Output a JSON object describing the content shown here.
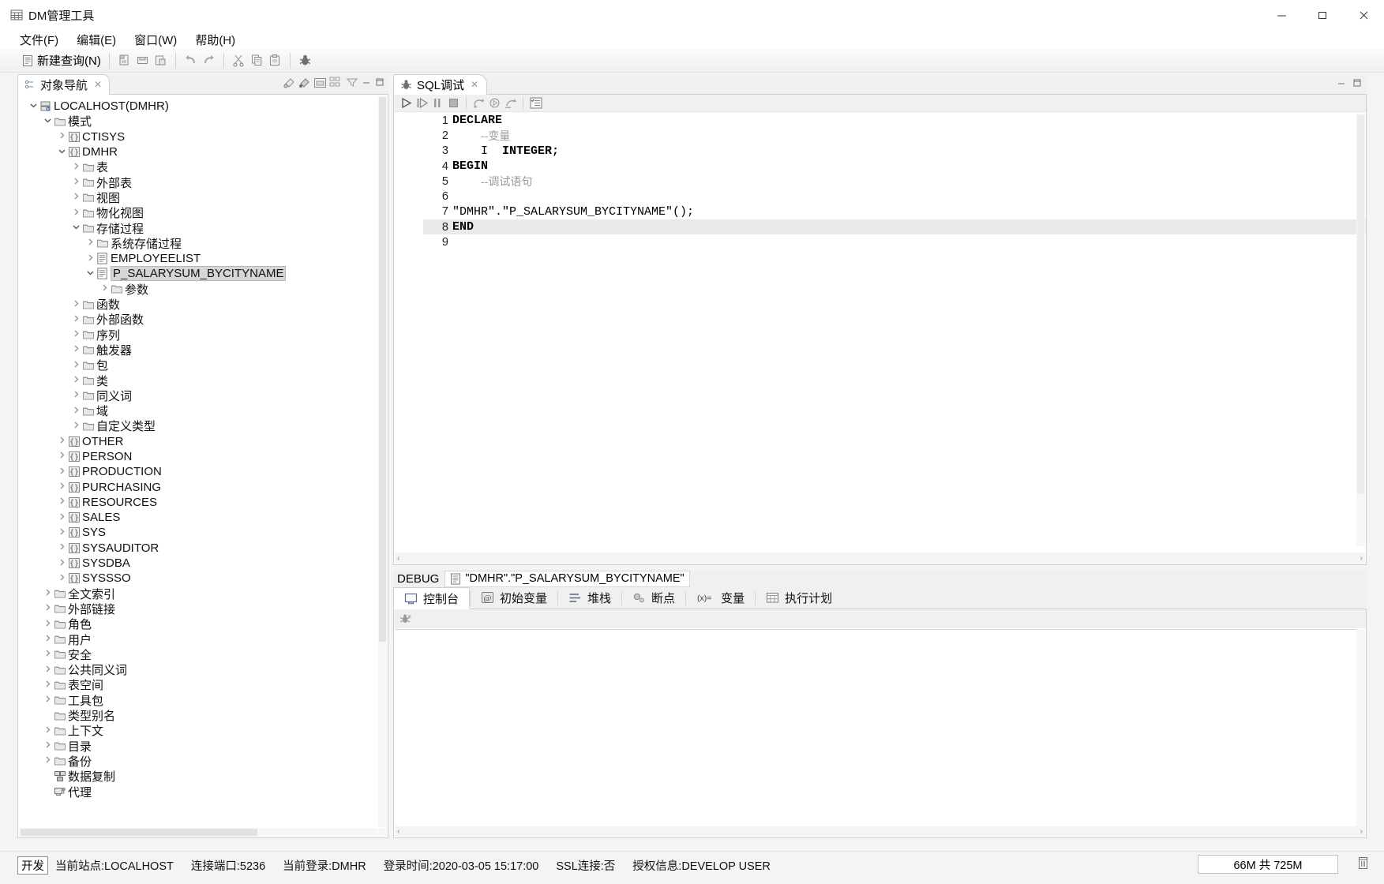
{
  "window": {
    "title": "DM管理工具",
    "icon": "app-grid-icon",
    "controls": {
      "minimize": "—",
      "maximize": "❐",
      "close": "✕"
    }
  },
  "menubar": {
    "items": [
      {
        "label": "文件(F)",
        "name": "menu-file"
      },
      {
        "label": "编辑(E)",
        "name": "menu-edit"
      },
      {
        "label": "窗口(W)",
        "name": "menu-window"
      },
      {
        "label": "帮助(H)",
        "name": "menu-help"
      }
    ]
  },
  "toolbar": {
    "new_query_label": "新建查询(N)",
    "icons": [
      "new-query-icon",
      "open-icon",
      "save-icon",
      "save-as-icon",
      "undo-icon",
      "redo-icon",
      "cut-icon",
      "copy-icon",
      "paste-icon",
      "debug-bug-icon"
    ]
  },
  "navigator": {
    "tab_label": "对象导航",
    "tab_close": "✕",
    "tools": [
      "refresh-connect-icon",
      "disconnect-icon",
      "new-folder-icon",
      "collapse-all-icon",
      "filter-icon",
      "minimize-icon",
      "maximize-icon"
    ],
    "tree": [
      {
        "label": "LOCALHOST(DMHR)",
        "depth": 0,
        "arrow": "down",
        "icon": "server-icon"
      },
      {
        "label": "模式",
        "depth": 1,
        "arrow": "down",
        "icon": "folder-icon"
      },
      {
        "label": "CTISYS",
        "depth": 2,
        "arrow": "right",
        "icon": "schema-icon"
      },
      {
        "label": "DMHR",
        "depth": 2,
        "arrow": "down",
        "icon": "schema-icon"
      },
      {
        "label": "表",
        "depth": 3,
        "arrow": "right",
        "icon": "folder-icon"
      },
      {
        "label": "外部表",
        "depth": 3,
        "arrow": "right",
        "icon": "folder-icon"
      },
      {
        "label": "视图",
        "depth": 3,
        "arrow": "right",
        "icon": "folder-icon"
      },
      {
        "label": "物化视图",
        "depth": 3,
        "arrow": "right",
        "icon": "folder-icon"
      },
      {
        "label": "存储过程",
        "depth": 3,
        "arrow": "down",
        "icon": "folder-icon"
      },
      {
        "label": "系统存储过程",
        "depth": 4,
        "arrow": "right",
        "icon": "folder-icon"
      },
      {
        "label": "EMPLOYEELIST",
        "depth": 4,
        "arrow": "right",
        "icon": "procedure-icon"
      },
      {
        "label": "P_SALARYSUM_BYCITYNAME",
        "depth": 4,
        "arrow": "down",
        "icon": "procedure-icon",
        "selected": true
      },
      {
        "label": "参数",
        "depth": 5,
        "arrow": "right",
        "icon": "folder-icon"
      },
      {
        "label": "函数",
        "depth": 3,
        "arrow": "right",
        "icon": "folder-icon"
      },
      {
        "label": "外部函数",
        "depth": 3,
        "arrow": "right",
        "icon": "folder-icon"
      },
      {
        "label": "序列",
        "depth": 3,
        "arrow": "right",
        "icon": "folder-icon"
      },
      {
        "label": "触发器",
        "depth": 3,
        "arrow": "right",
        "icon": "folder-icon"
      },
      {
        "label": "包",
        "depth": 3,
        "arrow": "right",
        "icon": "folder-icon"
      },
      {
        "label": "类",
        "depth": 3,
        "arrow": "right",
        "icon": "folder-icon"
      },
      {
        "label": "同义词",
        "depth": 3,
        "arrow": "right",
        "icon": "folder-icon"
      },
      {
        "label": "域",
        "depth": 3,
        "arrow": "right",
        "icon": "folder-icon"
      },
      {
        "label": "自定义类型",
        "depth": 3,
        "arrow": "right",
        "icon": "folder-icon"
      },
      {
        "label": "OTHER",
        "depth": 2,
        "arrow": "right",
        "icon": "schema-icon"
      },
      {
        "label": "PERSON",
        "depth": 2,
        "arrow": "right",
        "icon": "schema-icon"
      },
      {
        "label": "PRODUCTION",
        "depth": 2,
        "arrow": "right",
        "icon": "schema-icon"
      },
      {
        "label": "PURCHASING",
        "depth": 2,
        "arrow": "right",
        "icon": "schema-icon"
      },
      {
        "label": "RESOURCES",
        "depth": 2,
        "arrow": "right",
        "icon": "schema-icon"
      },
      {
        "label": "SALES",
        "depth": 2,
        "arrow": "right",
        "icon": "schema-icon"
      },
      {
        "label": "SYS",
        "depth": 2,
        "arrow": "right",
        "icon": "schema-icon"
      },
      {
        "label": "SYSAUDITOR",
        "depth": 2,
        "arrow": "right",
        "icon": "schema-icon"
      },
      {
        "label": "SYSDBA",
        "depth": 2,
        "arrow": "right",
        "icon": "schema-icon"
      },
      {
        "label": "SYSSSO",
        "depth": 2,
        "arrow": "right",
        "icon": "schema-icon"
      },
      {
        "label": "全文索引",
        "depth": 1,
        "arrow": "right",
        "icon": "folder-icon"
      },
      {
        "label": "外部链接",
        "depth": 1,
        "arrow": "right",
        "icon": "folder-icon"
      },
      {
        "label": "角色",
        "depth": 1,
        "arrow": "right",
        "icon": "folder-icon"
      },
      {
        "label": "用户",
        "depth": 1,
        "arrow": "right",
        "icon": "folder-icon"
      },
      {
        "label": "安全",
        "depth": 1,
        "arrow": "right",
        "icon": "folder-icon"
      },
      {
        "label": "公共同义词",
        "depth": 1,
        "arrow": "right",
        "icon": "folder-icon"
      },
      {
        "label": "表空间",
        "depth": 1,
        "arrow": "right",
        "icon": "folder-icon"
      },
      {
        "label": "工具包",
        "depth": 1,
        "arrow": "right",
        "icon": "folder-icon"
      },
      {
        "label": "类型别名",
        "depth": 1,
        "arrow": "none",
        "icon": "folder-icon"
      },
      {
        "label": "上下文",
        "depth": 1,
        "arrow": "right",
        "icon": "folder-icon"
      },
      {
        "label": "目录",
        "depth": 1,
        "arrow": "right",
        "icon": "folder-icon"
      },
      {
        "label": "备份",
        "depth": 1,
        "arrow": "right",
        "icon": "folder-icon"
      },
      {
        "label": "数据复制",
        "depth": 1,
        "arrow": "none",
        "icon": "replication-icon"
      },
      {
        "label": "代理",
        "depth": 1,
        "arrow": "none",
        "icon": "agent-icon"
      }
    ]
  },
  "editor": {
    "tab_label": "SQL调试",
    "tab_icon": "bug-icon",
    "tab_close": "✕",
    "view_tools": [
      "minimize-icon",
      "maximize-icon"
    ],
    "toolbar_icons": [
      "run-icon",
      "step-into-icon",
      "step-over-icon",
      "stop-icon",
      "step-return-icon",
      "resume-icon",
      "run-to-line-icon",
      "breakpoints-icon"
    ],
    "code": [
      {
        "num": "1",
        "segments": [
          {
            "text": "DECLARE",
            "style": "kw"
          }
        ]
      },
      {
        "num": "2",
        "segments": [
          {
            "text": "    ",
            "style": "plain"
          },
          {
            "text": "--变量",
            "style": "cmt"
          }
        ]
      },
      {
        "num": "3",
        "segments": [
          {
            "text": "    I  ",
            "style": "plain"
          },
          {
            "text": "INTEGER;",
            "style": "kw"
          }
        ]
      },
      {
        "num": "4",
        "segments": [
          {
            "text": "BEGIN",
            "style": "kw"
          }
        ]
      },
      {
        "num": "5",
        "segments": [
          {
            "text": "    ",
            "style": "plain"
          },
          {
            "text": "--调试语句",
            "style": "cmt"
          }
        ]
      },
      {
        "num": "6",
        "segments": [
          {
            "text": "",
            "style": "plain"
          }
        ]
      },
      {
        "num": "7",
        "segments": [
          {
            "text": "\"DMHR\".\"P_SALARYSUM_BYCITYNAME\"();",
            "style": "plain"
          }
        ]
      },
      {
        "num": "8",
        "segments": [
          {
            "text": "END",
            "style": "kw"
          }
        ],
        "current": true
      },
      {
        "num": "9",
        "segments": [
          {
            "text": "",
            "style": "plain"
          }
        ]
      }
    ],
    "hscroll_left": "‹",
    "hscroll_right": "›"
  },
  "debug_bar": {
    "label": "DEBUG",
    "target_icon": "procedure-icon",
    "target": "\"DMHR\".\"P_SALARYSUM_BYCITYNAME\""
  },
  "bottom": {
    "tabs": [
      {
        "label": "控制台",
        "icon": "console-icon",
        "active": true
      },
      {
        "label": "初始变量",
        "icon": "at-icon",
        "active": false
      },
      {
        "label": "堆栈",
        "icon": "stack-icon",
        "active": false
      },
      {
        "label": "断点",
        "icon": "breakpoint-icon",
        "active": false
      },
      {
        "label": "变量",
        "icon": "variable-icon",
        "active": false
      },
      {
        "label": "执行计划",
        "icon": "plan-icon",
        "active": false
      }
    ],
    "toolbar_icons": [
      "clear-console-icon"
    ],
    "hscroll_left": "‹",
    "hscroll_right": "›"
  },
  "statusbar": {
    "badge": "开发",
    "items": [
      "当前站点:LOCALHOST",
      "连接端口:5236",
      "当前登录:DMHR",
      "登录时间:2020-03-05 15:17:00",
      "SSL连接:否",
      "授权信息:DEVELOP USER"
    ],
    "memory": "66M 共 725M",
    "trash_icon": "trash-icon"
  },
  "colors": {
    "accent": "#3c7fb1",
    "panel_bg": "#f0f0f0",
    "border": "#cfcfcf",
    "selection": "#d6d6d6"
  }
}
